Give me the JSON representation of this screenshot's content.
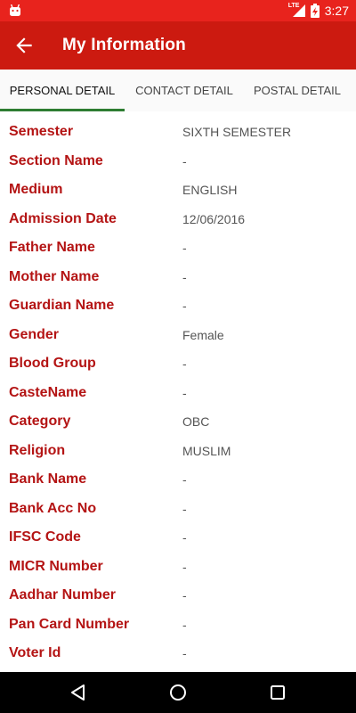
{
  "status_bar": {
    "time": "3:27",
    "network": "LTE",
    "icons": [
      "android-icon",
      "lte-signal-icon",
      "battery-charging-icon"
    ],
    "color": "#e8231d"
  },
  "app_bar": {
    "title": "My Information",
    "back_icon": "arrow-left-icon",
    "color": "#cc1a10"
  },
  "tabs": [
    {
      "label": "PERSONAL DETAIL",
      "active": true
    },
    {
      "label": "CONTACT DETAIL",
      "active": false
    },
    {
      "label": "POSTAL DETAIL",
      "active": false
    }
  ],
  "accent": {
    "tab_indicator": "#2e7d32",
    "label_color": "#b41414"
  },
  "details": [
    {
      "label": "Semester",
      "value": "SIXTH SEMESTER"
    },
    {
      "label": "Section Name",
      "value": "-"
    },
    {
      "label": "Medium",
      "value": "ENGLISH"
    },
    {
      "label": "Admission Date",
      "value": "12/06/2016"
    },
    {
      "label": "Father Name",
      "value": "-"
    },
    {
      "label": "Mother Name",
      "value": "-"
    },
    {
      "label": "Guardian Name",
      "value": "-"
    },
    {
      "label": "Gender",
      "value": "Female"
    },
    {
      "label": "Blood Group",
      "value": "-"
    },
    {
      "label": "CasteName",
      "value": "-"
    },
    {
      "label": "Category",
      "value": "OBC"
    },
    {
      "label": "Religion",
      "value": "MUSLIM"
    },
    {
      "label": "Bank Name",
      "value": "-"
    },
    {
      "label": "Bank Acc No",
      "value": "-"
    },
    {
      "label": "IFSC Code",
      "value": "-"
    },
    {
      "label": "MICR Number",
      "value": "-"
    },
    {
      "label": "Aadhar Number",
      "value": "-"
    },
    {
      "label": "Pan Card Number",
      "value": "-"
    },
    {
      "label": "Voter Id",
      "value": "-"
    }
  ],
  "nav_bar": {
    "icons": [
      "back-triangle-icon",
      "home-circle-icon",
      "recents-square-icon"
    ]
  }
}
